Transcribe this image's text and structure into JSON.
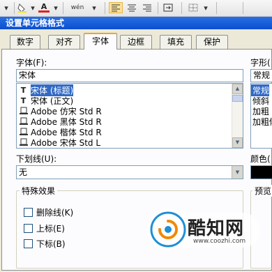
{
  "toolbar": {
    "phonetic_label": "wén",
    "font_color_glyph": "A"
  },
  "dialog": {
    "title": "设置单元格格式",
    "tabs": [
      {
        "label": "数字"
      },
      {
        "label": "对齐"
      },
      {
        "label": "字体",
        "active": true
      },
      {
        "label": "边框"
      },
      {
        "label": "填充"
      },
      {
        "label": "保护"
      }
    ],
    "font": {
      "label": "字体(F):",
      "value": "宋体",
      "list": [
        {
          "icon": "truetype-icon",
          "text": "宋体 (标题)",
          "selected": true
        },
        {
          "icon": "truetype-icon",
          "text": "宋体 (正文)"
        },
        {
          "icon": "opentype-icon",
          "text": "Adobe 仿宋 Std R"
        },
        {
          "icon": "opentype-icon",
          "text": "Adobe 黑体 Std R"
        },
        {
          "icon": "opentype-icon",
          "text": "Adobe 楷体 Std R"
        },
        {
          "icon": "opentype-icon",
          "text": "Adobe 宋体 Std L"
        }
      ]
    },
    "style": {
      "label": "字形(",
      "value": "常规",
      "list": [
        {
          "text": "常规",
          "selected": true
        },
        {
          "text": "倾斜"
        },
        {
          "text": "加粗"
        },
        {
          "text": "加粗倾"
        }
      ]
    },
    "underline": {
      "label": "下划线(U):",
      "value": "无"
    },
    "color": {
      "label": "颜色(",
      "value": "#000000"
    },
    "effects": {
      "title": "特殊效果",
      "items": [
        {
          "label": "删除线(K)"
        },
        {
          "label": "上标(E)"
        },
        {
          "label": "下标(B)"
        }
      ]
    },
    "preview": {
      "label": "预览"
    }
  },
  "watermark": {
    "name": "酷知网",
    "url": "www.coozhi.com"
  }
}
